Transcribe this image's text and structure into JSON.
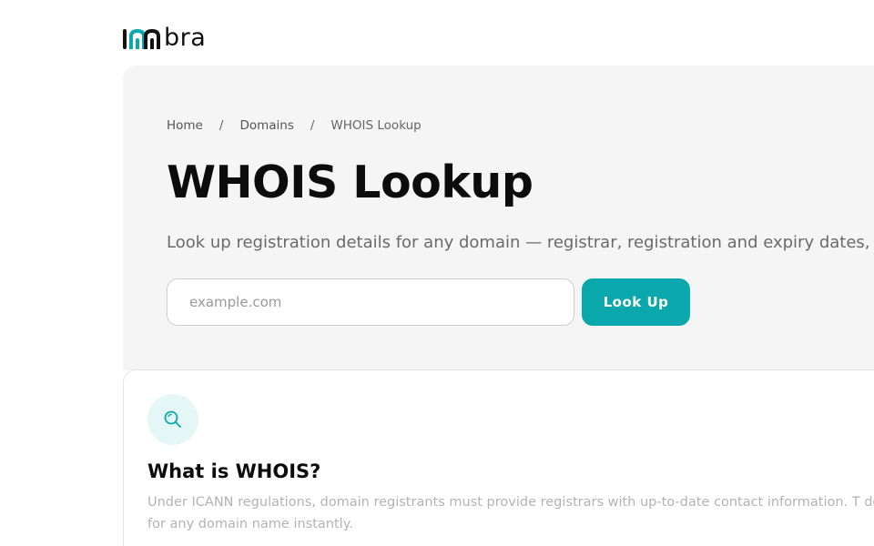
{
  "brand": {
    "name": "imbra",
    "text_suffix": "bra",
    "accent": "#0aa8ac"
  },
  "breadcrumb": {
    "items": [
      "Home",
      "Domains",
      "WHOIS Lookup"
    ],
    "separator": "/"
  },
  "hero": {
    "title": "WHOIS Lookup",
    "subtitle": "Look up registration details for any domain — registrar, registration and expiry dates,"
  },
  "search": {
    "placeholder": "example.com",
    "value": "",
    "button_label": "Look Up"
  },
  "info_card": {
    "icon": "search-icon",
    "title": "What is WHOIS?",
    "text": "Under ICANN regulations, domain registrants must provide registrars with up-to-date contact information. T details for any domain name instantly."
  },
  "colors": {
    "accent": "#0aa8ac",
    "hero_bg": "#f5f5f5",
    "icon_bg": "#e4f6f6"
  }
}
